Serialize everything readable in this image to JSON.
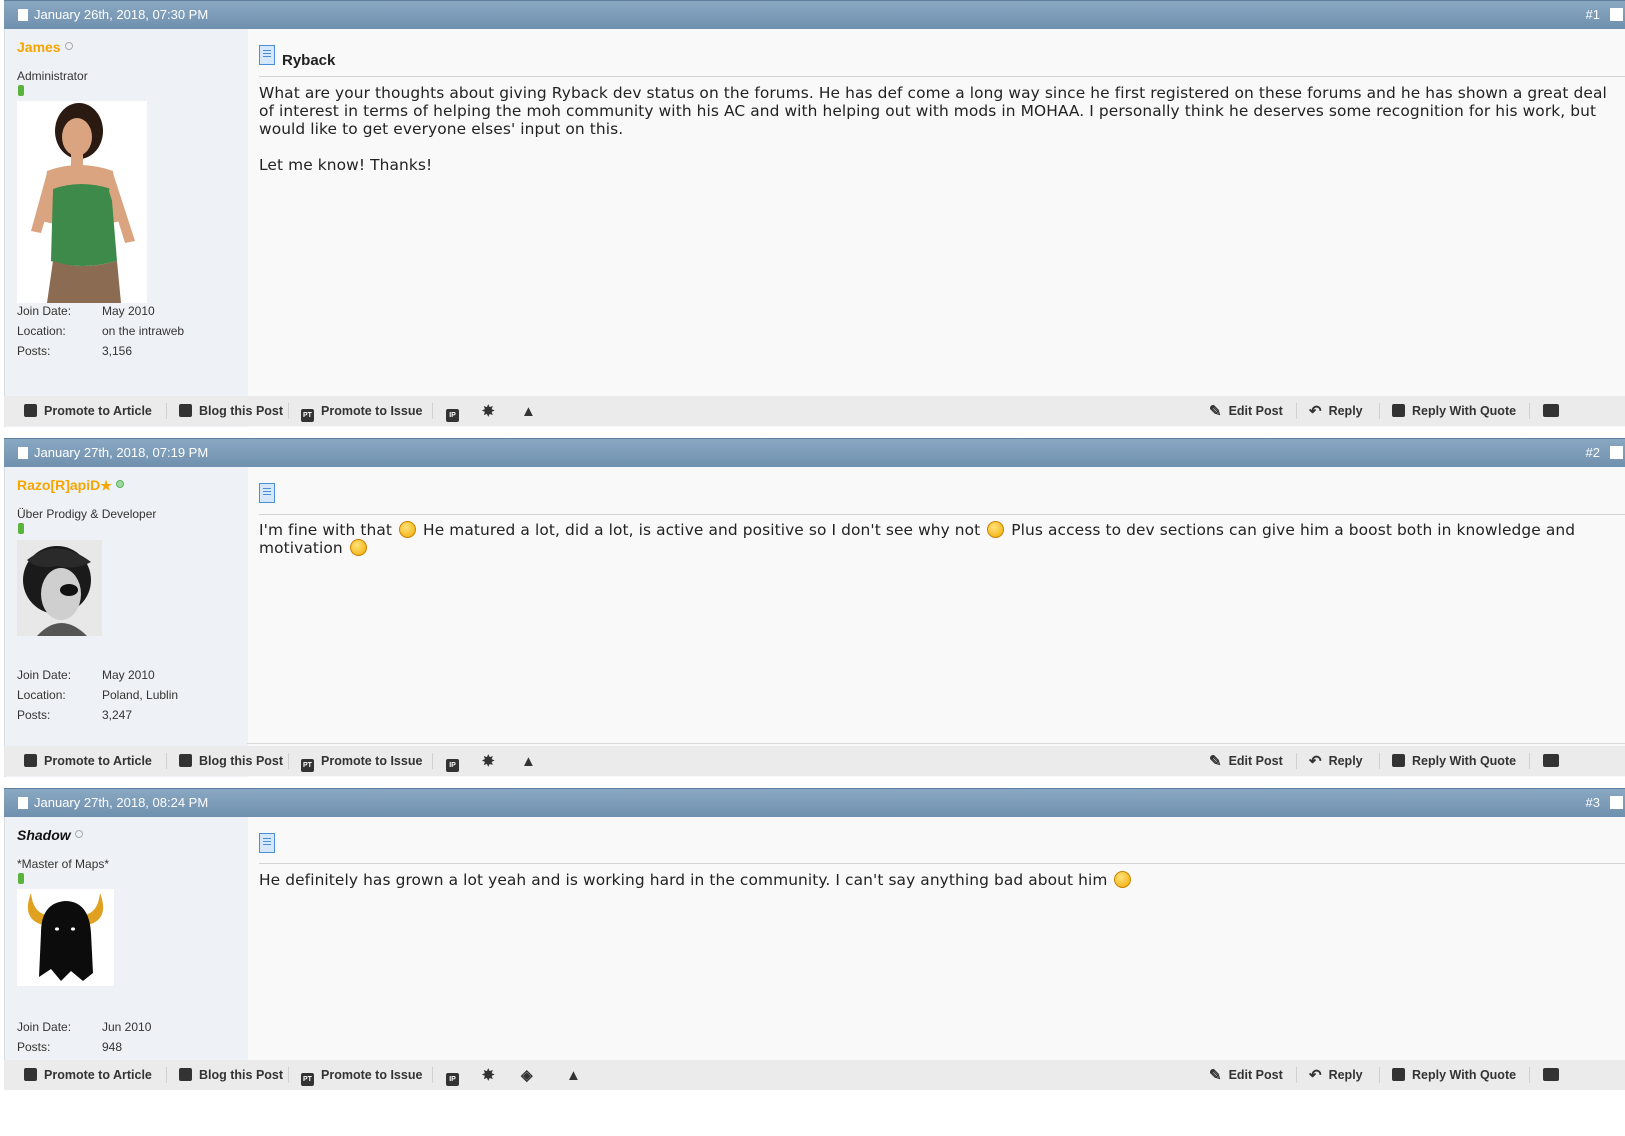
{
  "posts": [
    {
      "date": "January 26th, 2018, 07:30 PM",
      "number": "#1",
      "username": "James",
      "user_title": "Administrator",
      "join_date_label": "Join Date:",
      "join_date": "May 2010",
      "location_label": "Location:",
      "location": "on the intraweb",
      "posts_label": "Posts:",
      "posts": "3,156",
      "title": "Ryback",
      "message": "What are your thoughts about giving Ryback dev status on the forums. He has def come a long way since he first registered on these forums and he has shown a great deal of interest in terms of helping the moh community with his AC and with helping out with mods in MOHAA. I personally think he deserves some recognition for his work, but would like to get everyone elses' input on this.\n\nLet me know! Thanks!"
    },
    {
      "date": "January 27th, 2018, 07:19 PM",
      "number": "#2",
      "username": "Razo[R]apiD",
      "user_title": "Über Prodigy & Developer",
      "join_date_label": "Join Date:",
      "join_date": "May 2010",
      "location_label": "Location:",
      "location": "Poland, Lublin",
      "posts_label": "Posts:",
      "posts": "3,247",
      "message_parts": [
        "I'm fine with that ",
        " He matured a lot, did a lot, is active and positive so I don't see why not ",
        " Plus access to dev sections can give him a boost both in knowledge and motivation "
      ]
    },
    {
      "date": "January 27th, 2018, 08:24 PM",
      "number": "#3",
      "username": "Shadow",
      "user_title": "*Master of Maps*",
      "join_date_label": "Join Date:",
      "join_date": "Jun 2010",
      "posts_label": "Posts:",
      "posts": "948",
      "message_parts": [
        "He definitely has grown a lot yeah and is working hard in the community. I can't say anything bad about him "
      ]
    }
  ],
  "toolbar": {
    "promote_article": "Promote to Article",
    "blog_post": "Blog this Post",
    "promote_issue": "Promote to Issue",
    "edit_post": "Edit Post",
    "reply": "Reply",
    "reply_quote": "Reply With Quote"
  },
  "icons": {
    "smiley": "smiley-icon",
    "ip": "IP",
    "pt": "PT"
  }
}
